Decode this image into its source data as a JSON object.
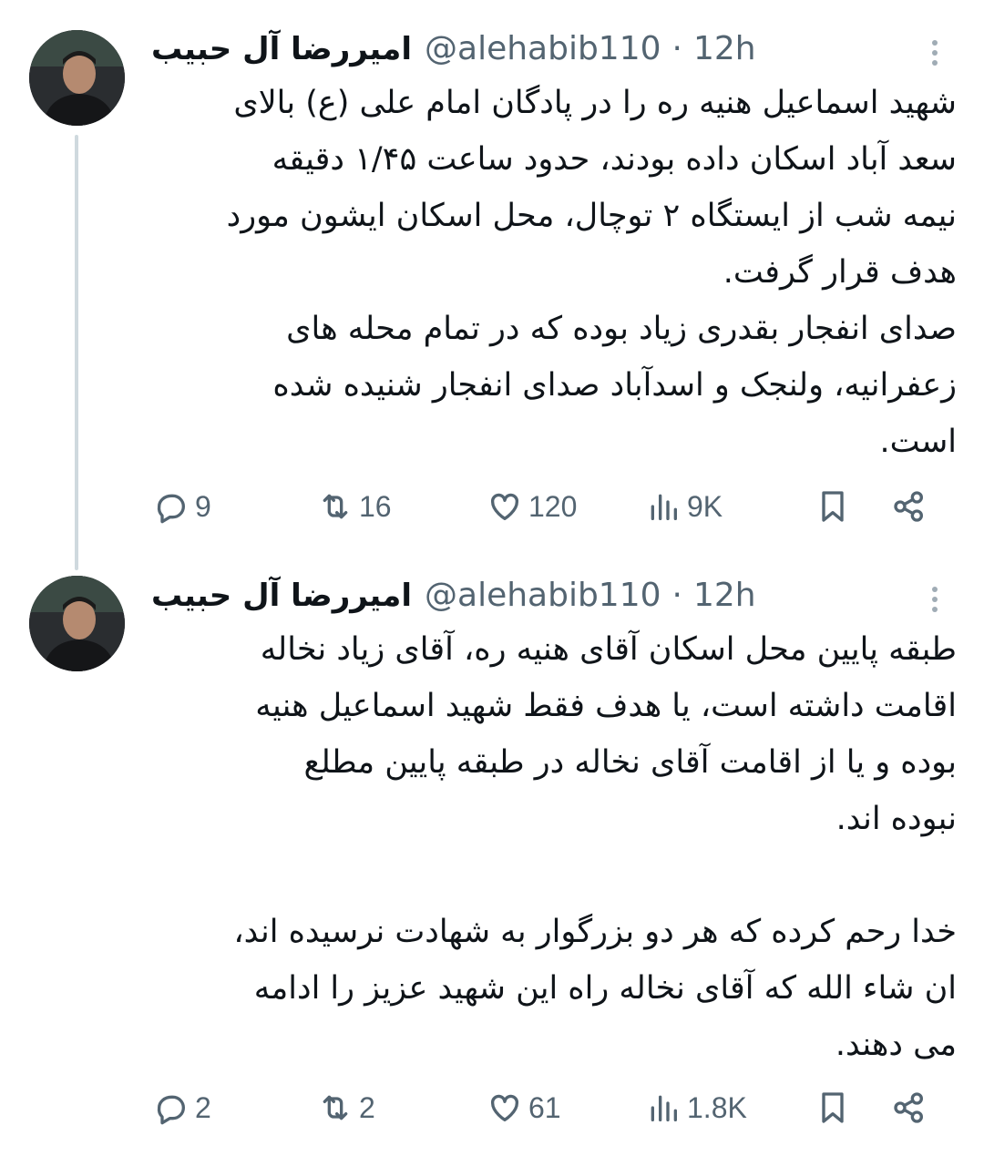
{
  "tweets": [
    {
      "author_name": "امیررضا آل حبیب",
      "handle": "@alehabib110",
      "separator": "·",
      "time": "12h",
      "paragraphs": [
        "شهید اسماعیل هنیه ره را در پادگان امام علی (ع) بالای\nسعد آباد اسکان داده بودند، حدود ساعت ۱/۴۵ دقیقه\nنیمه شب از ایستگاه ۲ توچال، محل اسکان ایشون مورد\nهدف قرار گرفت.",
        "صدای انفجار بقدری زیاد بوده که در تمام محله های\nزعفرانیه، ولنجک و اسدآباد صدای انفجار شنیده شده\nاست."
      ],
      "stats": {
        "replies": "9",
        "retweets": "16",
        "likes": "120",
        "views": "9K"
      }
    },
    {
      "author_name": "امیررضا آل حبیب",
      "handle": "@alehabib110",
      "separator": "·",
      "time": "12h",
      "paragraphs": [
        "طبقه پایین محل اسکان آقای هنیه ره، آقای زیاد نخاله\nاقامت داشته است، یا هدف فقط شهید اسماعیل هنیه\nبوده و یا از اقامت آقای نخاله در طبقه پایین مطلع\nنبوده اند.",
        "خدا رحم کرده که هر دو بزرگوار به شهادت نرسیده اند،\nان شاء الله که آقای نخاله راه این شهید عزیز را ادامه\nمی دهند."
      ],
      "stats": {
        "replies": "2",
        "retweets": "2",
        "likes": "61",
        "views": "1.8K"
      }
    }
  ],
  "icons": {
    "reply": "speech-bubble-icon",
    "retweet": "retweet-arrows-icon",
    "like": "heart-icon",
    "views": "bar-chart-icon",
    "bookmark": "bookmark-icon",
    "share": "share-nodes-icon",
    "more": "vertical-ellipsis-icon"
  },
  "colors": {
    "text": "#0f1419",
    "muted": "#536471",
    "thread_line": "#cfd9de"
  }
}
